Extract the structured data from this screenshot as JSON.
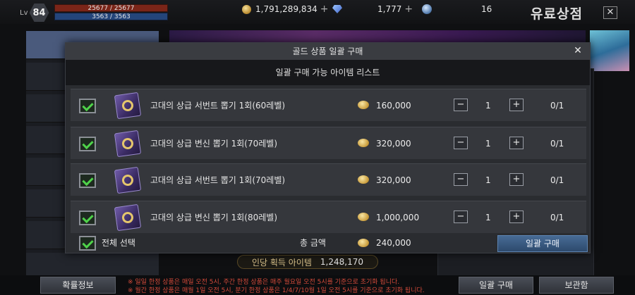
{
  "player": {
    "level_label": "Lv",
    "level": "84",
    "hp": "25677 / 25677",
    "mp": "3563 / 3563"
  },
  "currencies": {
    "gold": "1,791,289,834",
    "diamond": "1,777",
    "orb": "16"
  },
  "shop": {
    "title": "유료상점",
    "close": "✕",
    "gain_label": "인당 획득 아이템",
    "gain_value": "1,248,170"
  },
  "modal": {
    "title": "골드 상품 일괄 구매",
    "subtitle": "일괄 구매 가능 아이템 리스트",
    "close": "✕",
    "items": [
      {
        "name": "고대의 상급 서번트 뽑기 1회(60레벨)",
        "price": "160,000",
        "qty": "1",
        "limit": "0/1",
        "checked": true
      },
      {
        "name": "고대의 상급 변신 뽑기 1회(70레벨)",
        "price": "320,000",
        "qty": "1",
        "limit": "0/1",
        "checked": true
      },
      {
        "name": "고대의 상급 서번트 뽑기 1회(70레벨)",
        "price": "320,000",
        "qty": "1",
        "limit": "0/1",
        "checked": true
      },
      {
        "name": "고대의 상급 변신 뽑기 1회(80레벨)",
        "price": "1,000,000",
        "qty": "1",
        "limit": "0/1",
        "checked": true
      }
    ],
    "minus": "−",
    "plus": "+",
    "select_all": "전체 선택",
    "total_label": "총 금액",
    "total_value": "240,000",
    "buy_all": "일괄 구매"
  },
  "bottom": {
    "prob_info": "확률정보",
    "buy_all": "일괄 구매",
    "storage": "보관함",
    "notice1": "※ 일일 한정 상품은 매일 오전 5시, 주간 한정 상품은 매주 월요일 오전 5시를 기준으로 초기화 됩니다.",
    "notice2": "※ 월간 한정 상품은 매월 1일 오전 5시, 분기 한정 상품은 1/4/7/10월 1일 오전 5시를 기준으로 초기화 됩니다."
  }
}
